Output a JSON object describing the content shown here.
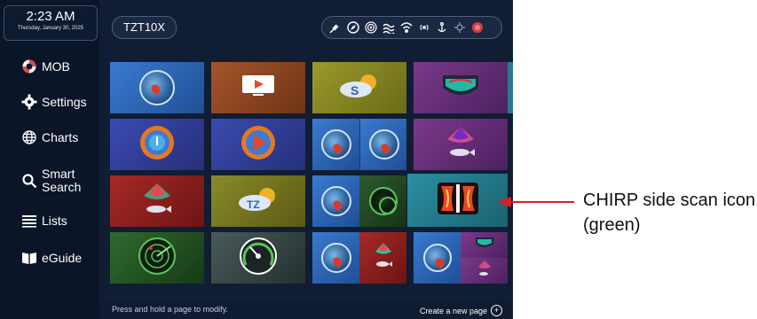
{
  "clock": {
    "time": "2:23 AM",
    "date": "Thursday, January 30, 2025"
  },
  "sidebar": {
    "items": [
      {
        "label": "MOB",
        "icon": "lifebuoy-icon"
      },
      {
        "label": "Settings",
        "icon": "gear-icon"
      },
      {
        "label": "Charts",
        "icon": "globe-icon"
      },
      {
        "label": "Smart\nSearch",
        "icon": "search-icon"
      },
      {
        "label": "Lists",
        "icon": "list-icon"
      },
      {
        "label": "eGuide",
        "icon": "book-icon"
      }
    ]
  },
  "header": {
    "title": "TZT10X"
  },
  "status_icons": [
    "satellite-icon",
    "compass-icon",
    "sonar-signal-icon",
    "tide-icon",
    "wifi-icon",
    "broadcast-icon",
    "anchor-icon",
    "alarm-icon",
    "stop-icon"
  ],
  "footer": {
    "hint": "Press and hold a page to modify.",
    "create_label": "Create a new page"
  },
  "annotation": {
    "text": "CHIRP side scan icon (green)",
    "color": "#d81e2a"
  },
  "colors": {
    "screen_bg": "#101d33",
    "accent_green": "#58c558",
    "annotation_red": "#d81e2a"
  }
}
